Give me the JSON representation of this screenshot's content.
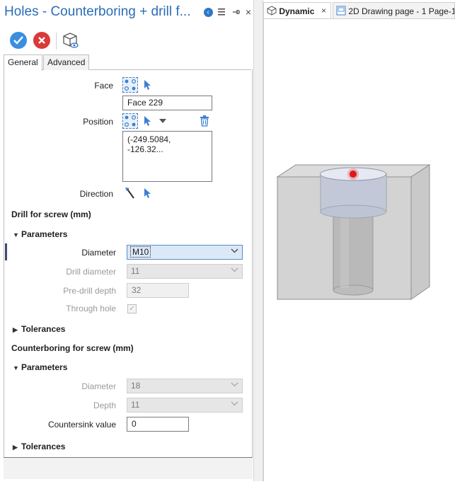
{
  "panel": {
    "title": "Holes - Counterboring + drill f...",
    "controls": {
      "back": "back-icon",
      "menu": "menu-icon",
      "pin": "pin-icon",
      "close": "close-icon"
    }
  },
  "toolbar": {
    "ok": "check-icon",
    "cancel": "x-icon",
    "preview": "preview-icon"
  },
  "tabs": [
    "General",
    "Advanced"
  ],
  "general": {
    "face": {
      "label": "Face",
      "value": "Face 229"
    },
    "position": {
      "label": "Position",
      "value": "(-249.5084, -126.32..."
    },
    "direction": {
      "label": "Direction"
    },
    "drill_section": "Drill for screw (mm)",
    "drill_params": {
      "header": "Parameters",
      "diameter": {
        "label": "Diameter",
        "value": "M10"
      },
      "drill_diameter": {
        "label": "Drill diameter",
        "value": "11"
      },
      "pre_drill_depth": {
        "label": "Pre-drill depth",
        "value": "32"
      },
      "through_hole": {
        "label": "Through hole",
        "checked": true
      }
    },
    "drill_tolerances": "Tolerances",
    "counterbore_section": "Counterboring for screw (mm)",
    "counterbore_params": {
      "header": "Parameters",
      "diameter": {
        "label": "Diameter",
        "value": "18"
      },
      "depth": {
        "label": "Depth",
        "value": "11"
      },
      "countersink": {
        "label": "Countersink value",
        "value": "0"
      }
    },
    "counterbore_tolerances": "Tolerances"
  },
  "documents": {
    "tabs": [
      {
        "label": "Dynamic",
        "close": "×"
      },
      {
        "label": "2D Drawing page - 1 Page-1"
      }
    ]
  },
  "colors": {
    "accent": "#2b6cb8",
    "ok": "#3b8ee0",
    "cancel": "#d93a3a",
    "marker": "#e01818"
  }
}
